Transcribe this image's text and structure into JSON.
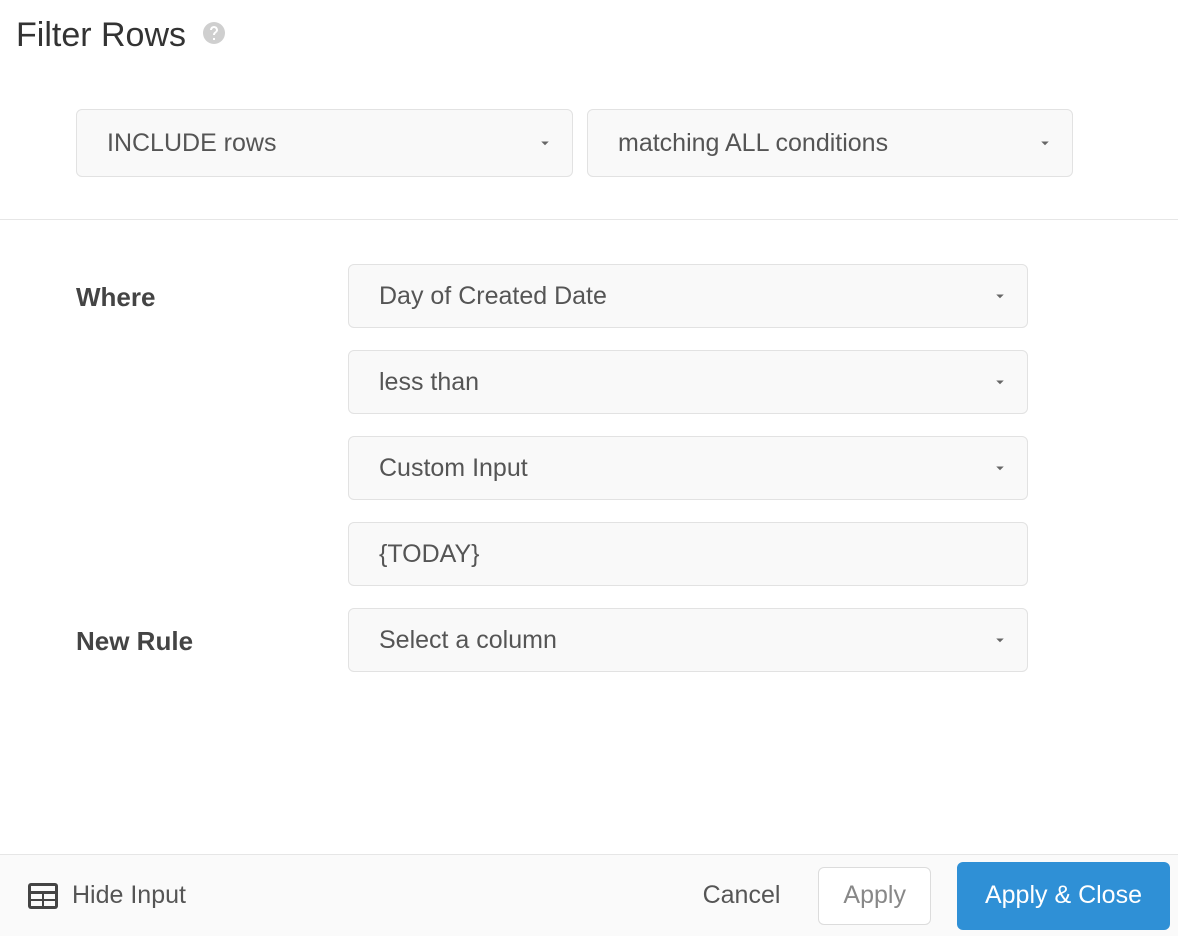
{
  "header": {
    "title": "Filter Rows"
  },
  "scope": {
    "include_label": "INCLUDE rows",
    "match_label": "matching ALL conditions"
  },
  "rule": {
    "where_label": "Where",
    "column_value": "Day of Created Date",
    "operator_value": "less than",
    "input_mode_value": "Custom Input",
    "custom_value": "{TODAY}"
  },
  "new_rule": {
    "label": "New Rule",
    "column_placeholder": "Select a column"
  },
  "footer": {
    "hide_input_label": "Hide Input",
    "cancel_label": "Cancel",
    "apply_label": "Apply",
    "apply_close_label": "Apply & Close"
  }
}
